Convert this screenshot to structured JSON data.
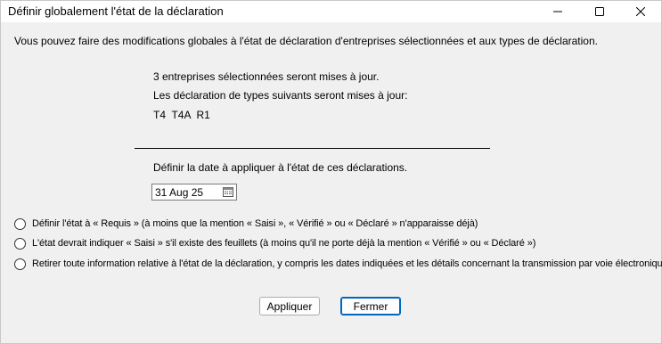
{
  "window": {
    "title": "Définir globalement l'état de la déclaration"
  },
  "intro": "Vous pouvez faire des modifications globales à l'état de déclaration d'entreprises sélectionnées et aux types de déclaration.",
  "summary": {
    "companies": "3 entreprises sélectionnées seront mises à jour.",
    "types_intro": "Les déclaration de types suivants seront mises à jour:",
    "types": "T4  T4A  R1"
  },
  "date": {
    "label": "Définir la date à appliquer à l'état de ces déclarations.",
    "value": "31 Aug 25"
  },
  "options": [
    {
      "label": "Définir l'état à « Requis » (à moins que la mention « Saisi », « Vérifié » ou « Déclaré » n'apparaisse déjà)",
      "selected": false
    },
    {
      "label": "L'état devrait indiquer « Saisi » s'il existe des feuillets (à moins qu'il ne porte déjà la mention « Vérifié » ou « Déclaré »)",
      "selected": false
    },
    {
      "label": "Retirer toute information relative à l'état de la déclaration, y compris les dates indiquées et les détails concernant la transmission par voie électronique",
      "selected": false
    }
  ],
  "buttons": {
    "apply": "Appliquer",
    "close": "Fermer"
  },
  "colors": {
    "background": "#f0f0f0",
    "default_button_border": "#0067c0"
  }
}
